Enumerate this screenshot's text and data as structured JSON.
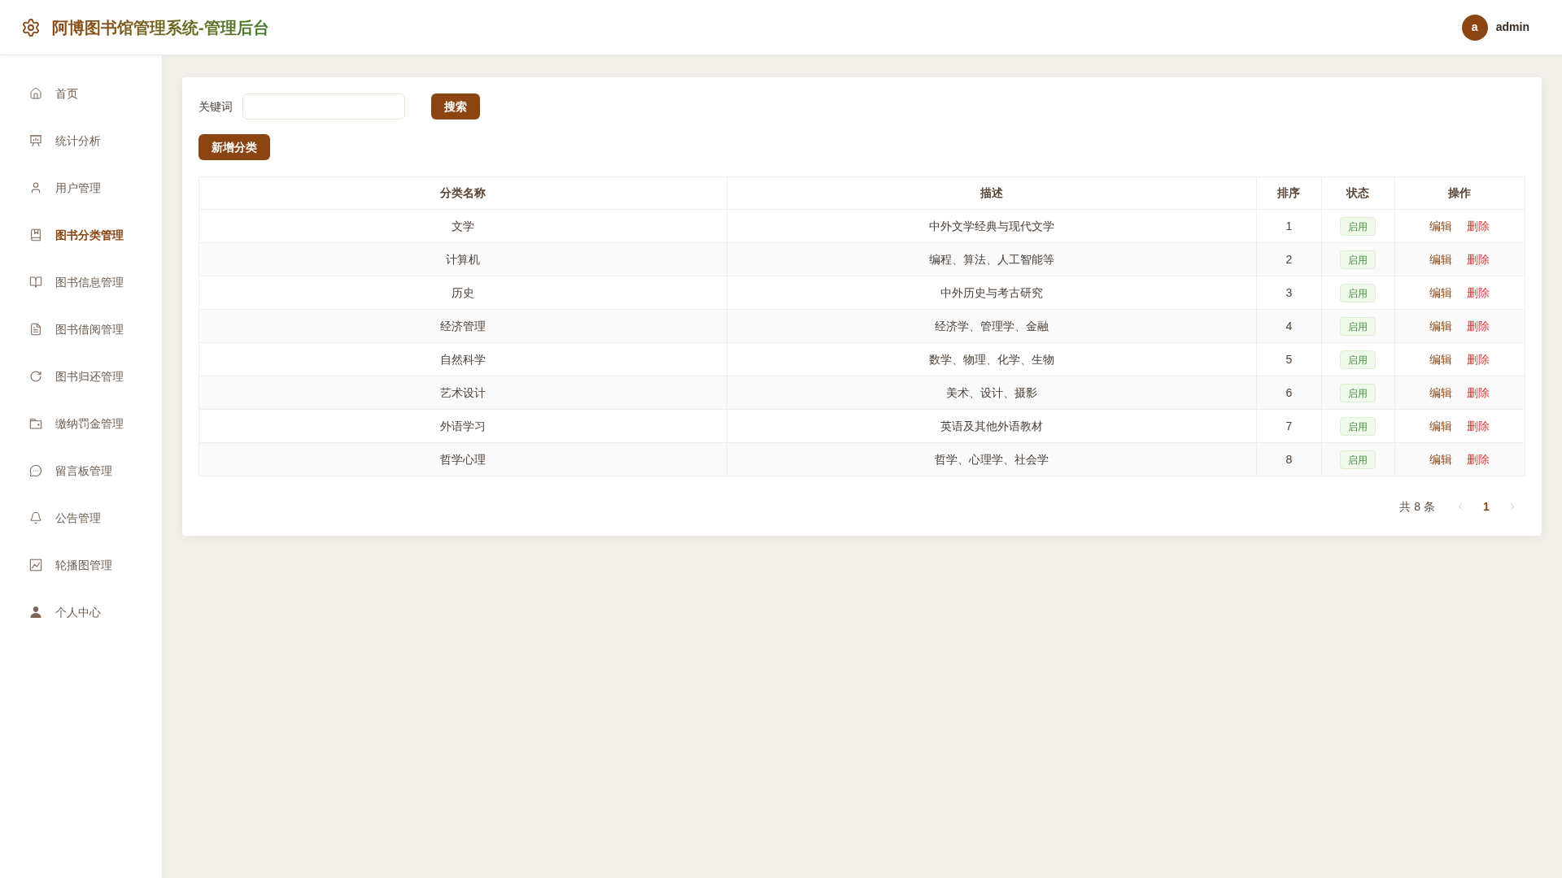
{
  "header": {
    "title": "阿博图书馆管理系统-管理后台",
    "user": {
      "avatar": "a",
      "name": "admin"
    }
  },
  "sidebar": {
    "items": [
      {
        "label": "首页",
        "selected": false
      },
      {
        "label": "统计分析",
        "selected": false
      },
      {
        "label": "用户管理",
        "selected": false
      },
      {
        "label": "图书分类管理",
        "selected": true
      },
      {
        "label": "图书信息管理",
        "selected": false
      },
      {
        "label": "图书借阅管理",
        "selected": false
      },
      {
        "label": "图书归还管理",
        "selected": false
      },
      {
        "label": "缴纳罚金管理",
        "selected": false
      },
      {
        "label": "留言板管理",
        "selected": false
      },
      {
        "label": "公告管理",
        "selected": false
      },
      {
        "label": "轮播图管理",
        "selected": false
      },
      {
        "label": "个人中心",
        "selected": false
      }
    ]
  },
  "search": {
    "label": "关键词",
    "button": "搜索"
  },
  "toolbar": {
    "add_button": "新增分类"
  },
  "table": {
    "columns": [
      "分类名称",
      "描述",
      "排序",
      "状态",
      "操作"
    ],
    "rows": [
      {
        "cells": [
          "文学",
          "中外文学经典与现代文学",
          "1"
        ],
        "status": "启用",
        "actions": [
          {
            "label": "编辑",
            "kind": "edit"
          },
          {
            "label": "删除",
            "kind": "delete"
          }
        ]
      },
      {
        "cells": [
          "计算机",
          "编程、算法、人工智能等",
          "2"
        ],
        "status": "启用",
        "actions": [
          {
            "label": "编辑",
            "kind": "edit"
          },
          {
            "label": "删除",
            "kind": "delete"
          }
        ]
      },
      {
        "cells": [
          "历史",
          "中外历史与考古研究",
          "3"
        ],
        "status": "启用",
        "actions": [
          {
            "label": "编辑",
            "kind": "edit"
          },
          {
            "label": "删除",
            "kind": "delete"
          }
        ]
      },
      {
        "cells": [
          "经济管理",
          "经济学、管理学、金融",
          "4"
        ],
        "status": "启用",
        "actions": [
          {
            "label": "编辑",
            "kind": "edit"
          },
          {
            "label": "删除",
            "kind": "delete"
          }
        ]
      },
      {
        "cells": [
          "自然科学",
          "数学、物理、化学、生物",
          "5"
        ],
        "status": "启用",
        "actions": [
          {
            "label": "编辑",
            "kind": "edit"
          },
          {
            "label": "删除",
            "kind": "delete"
          }
        ]
      },
      {
        "cells": [
          "艺术设计",
          "美术、设计、摄影",
          "6"
        ],
        "status": "启用",
        "actions": [
          {
            "label": "编辑",
            "kind": "edit"
          },
          {
            "label": "删除",
            "kind": "delete"
          }
        ]
      },
      {
        "cells": [
          "外语学习",
          "英语及其他外语教材",
          "7"
        ],
        "status": "启用",
        "actions": [
          {
            "label": "编辑",
            "kind": "edit"
          },
          {
            "label": "删除",
            "kind": "delete"
          }
        ]
      },
      {
        "cells": [
          "哲学心理",
          "哲学、心理学、社会学",
          "8"
        ],
        "status": "启用",
        "actions": [
          {
            "label": "编辑",
            "kind": "edit"
          },
          {
            "label": "删除",
            "kind": "delete"
          }
        ]
      }
    ]
  },
  "pagination": {
    "total": "共 8 条",
    "prev": {
      "disabled": true
    },
    "pages": [
      {
        "label": "1",
        "selected": true
      }
    ],
    "next": {
      "disabled": true
    }
  }
}
